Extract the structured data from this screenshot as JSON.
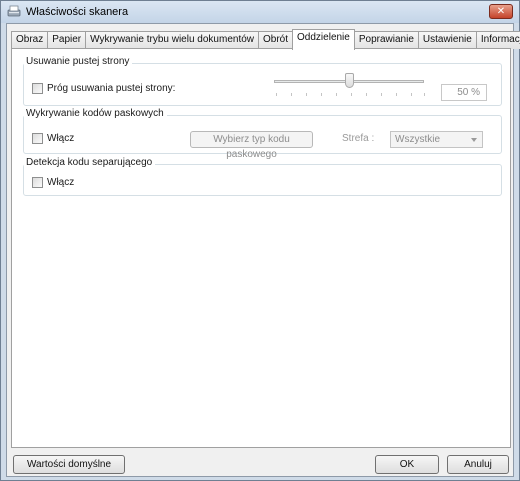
{
  "window": {
    "title": "Właściwości skanera",
    "close": "✕"
  },
  "tabs": [
    {
      "label": "Obraz"
    },
    {
      "label": "Papier"
    },
    {
      "label": "Wykrywanie trybu wielu dokumentów"
    },
    {
      "label": "Obrót"
    },
    {
      "label": "Oddzielenie",
      "active": true
    },
    {
      "label": "Poprawianie"
    },
    {
      "label": "Ustawienie"
    },
    {
      "label": "Informacje"
    }
  ],
  "blank_page_removal": {
    "title": "Usuwanie pustej strony",
    "checkbox_label": "Próg usuwania pustej strony:",
    "checked": false,
    "slider_value_percent": 50,
    "value_text": "50 %"
  },
  "barcode_detection": {
    "title": "Wykrywanie kodów paskowych",
    "checkbox_label": "Włącz",
    "checked": false,
    "select_type_button": "Wybierz typ kodu paskowego",
    "zone_label": "Strefa :",
    "zone_value": "Wszystkie"
  },
  "separator_detection": {
    "title": "Detekcja kodu separującego",
    "checkbox_label": "Włącz",
    "checked": false
  },
  "footer": {
    "defaults_button": "Wartości domyślne",
    "ok_button": "OK",
    "cancel_button": "Anuluj"
  }
}
